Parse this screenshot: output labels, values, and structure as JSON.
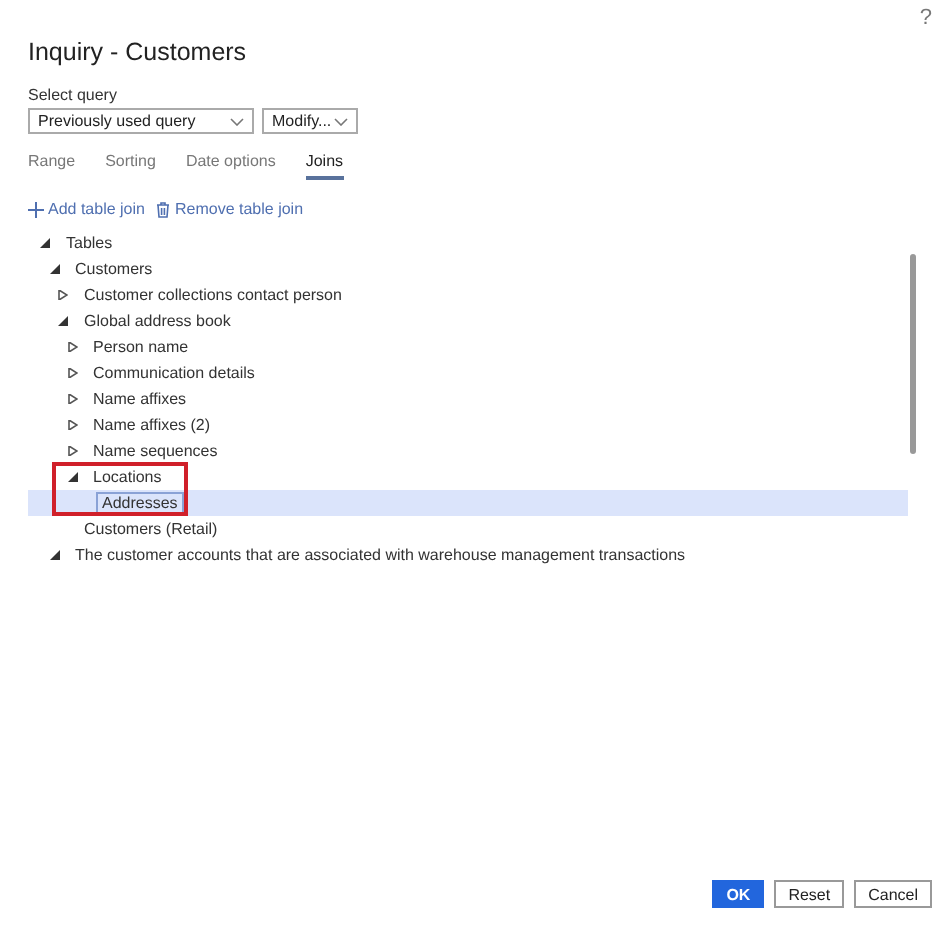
{
  "window": {
    "title": "Inquiry - Customers",
    "help": "?"
  },
  "select_query": {
    "label": "Select query",
    "value": "Previously used query",
    "modify": "Modify..."
  },
  "tabs": [
    {
      "label": "Range",
      "selected": false
    },
    {
      "label": "Sorting",
      "selected": false
    },
    {
      "label": "Date options",
      "selected": false
    },
    {
      "label": "Joins",
      "selected": true
    }
  ],
  "toolbar": [
    {
      "kind": "add",
      "label": "Add table join"
    },
    {
      "kind": "remove",
      "label": "Remove table join"
    }
  ],
  "tree": [
    {
      "label": "Tables",
      "expanded": true,
      "selected": false,
      "children": [
        {
          "label": "Customers",
          "expanded": true,
          "selected": false,
          "children": [
            {
              "label": "Customer collections contact person",
              "expanded": false,
              "selected": false
            },
            {
              "label": "Global address book",
              "expanded": true,
              "selected": false,
              "children": [
                {
                  "label": "Person name",
                  "expanded": false,
                  "selected": false
                },
                {
                  "label": "Communication details",
                  "expanded": false,
                  "selected": false
                },
                {
                  "label": "Name affixes",
                  "expanded": false,
                  "selected": false
                },
                {
                  "label": "Name affixes (2)",
                  "expanded": false,
                  "selected": false
                },
                {
                  "label": "Name sequences",
                  "expanded": false,
                  "selected": false
                },
                {
                  "label": "Locations",
                  "expanded": true,
                  "selected": false,
                  "highlighted": true,
                  "children": [
                    {
                      "label": "Addresses",
                      "selected": true
                    }
                  ]
                }
              ]
            },
            {
              "label": "Customers (Retail)",
              "selected": false
            }
          ]
        },
        {
          "label": "The customer accounts that are associated with warehouse management transactions",
          "expanded": true,
          "selected": false
        }
      ]
    }
  ],
  "buttons": [
    {
      "label": "OK",
      "kind": "primary"
    },
    {
      "label": "Reset",
      "kind": "default"
    },
    {
      "label": "Cancel",
      "kind": "default"
    }
  ]
}
